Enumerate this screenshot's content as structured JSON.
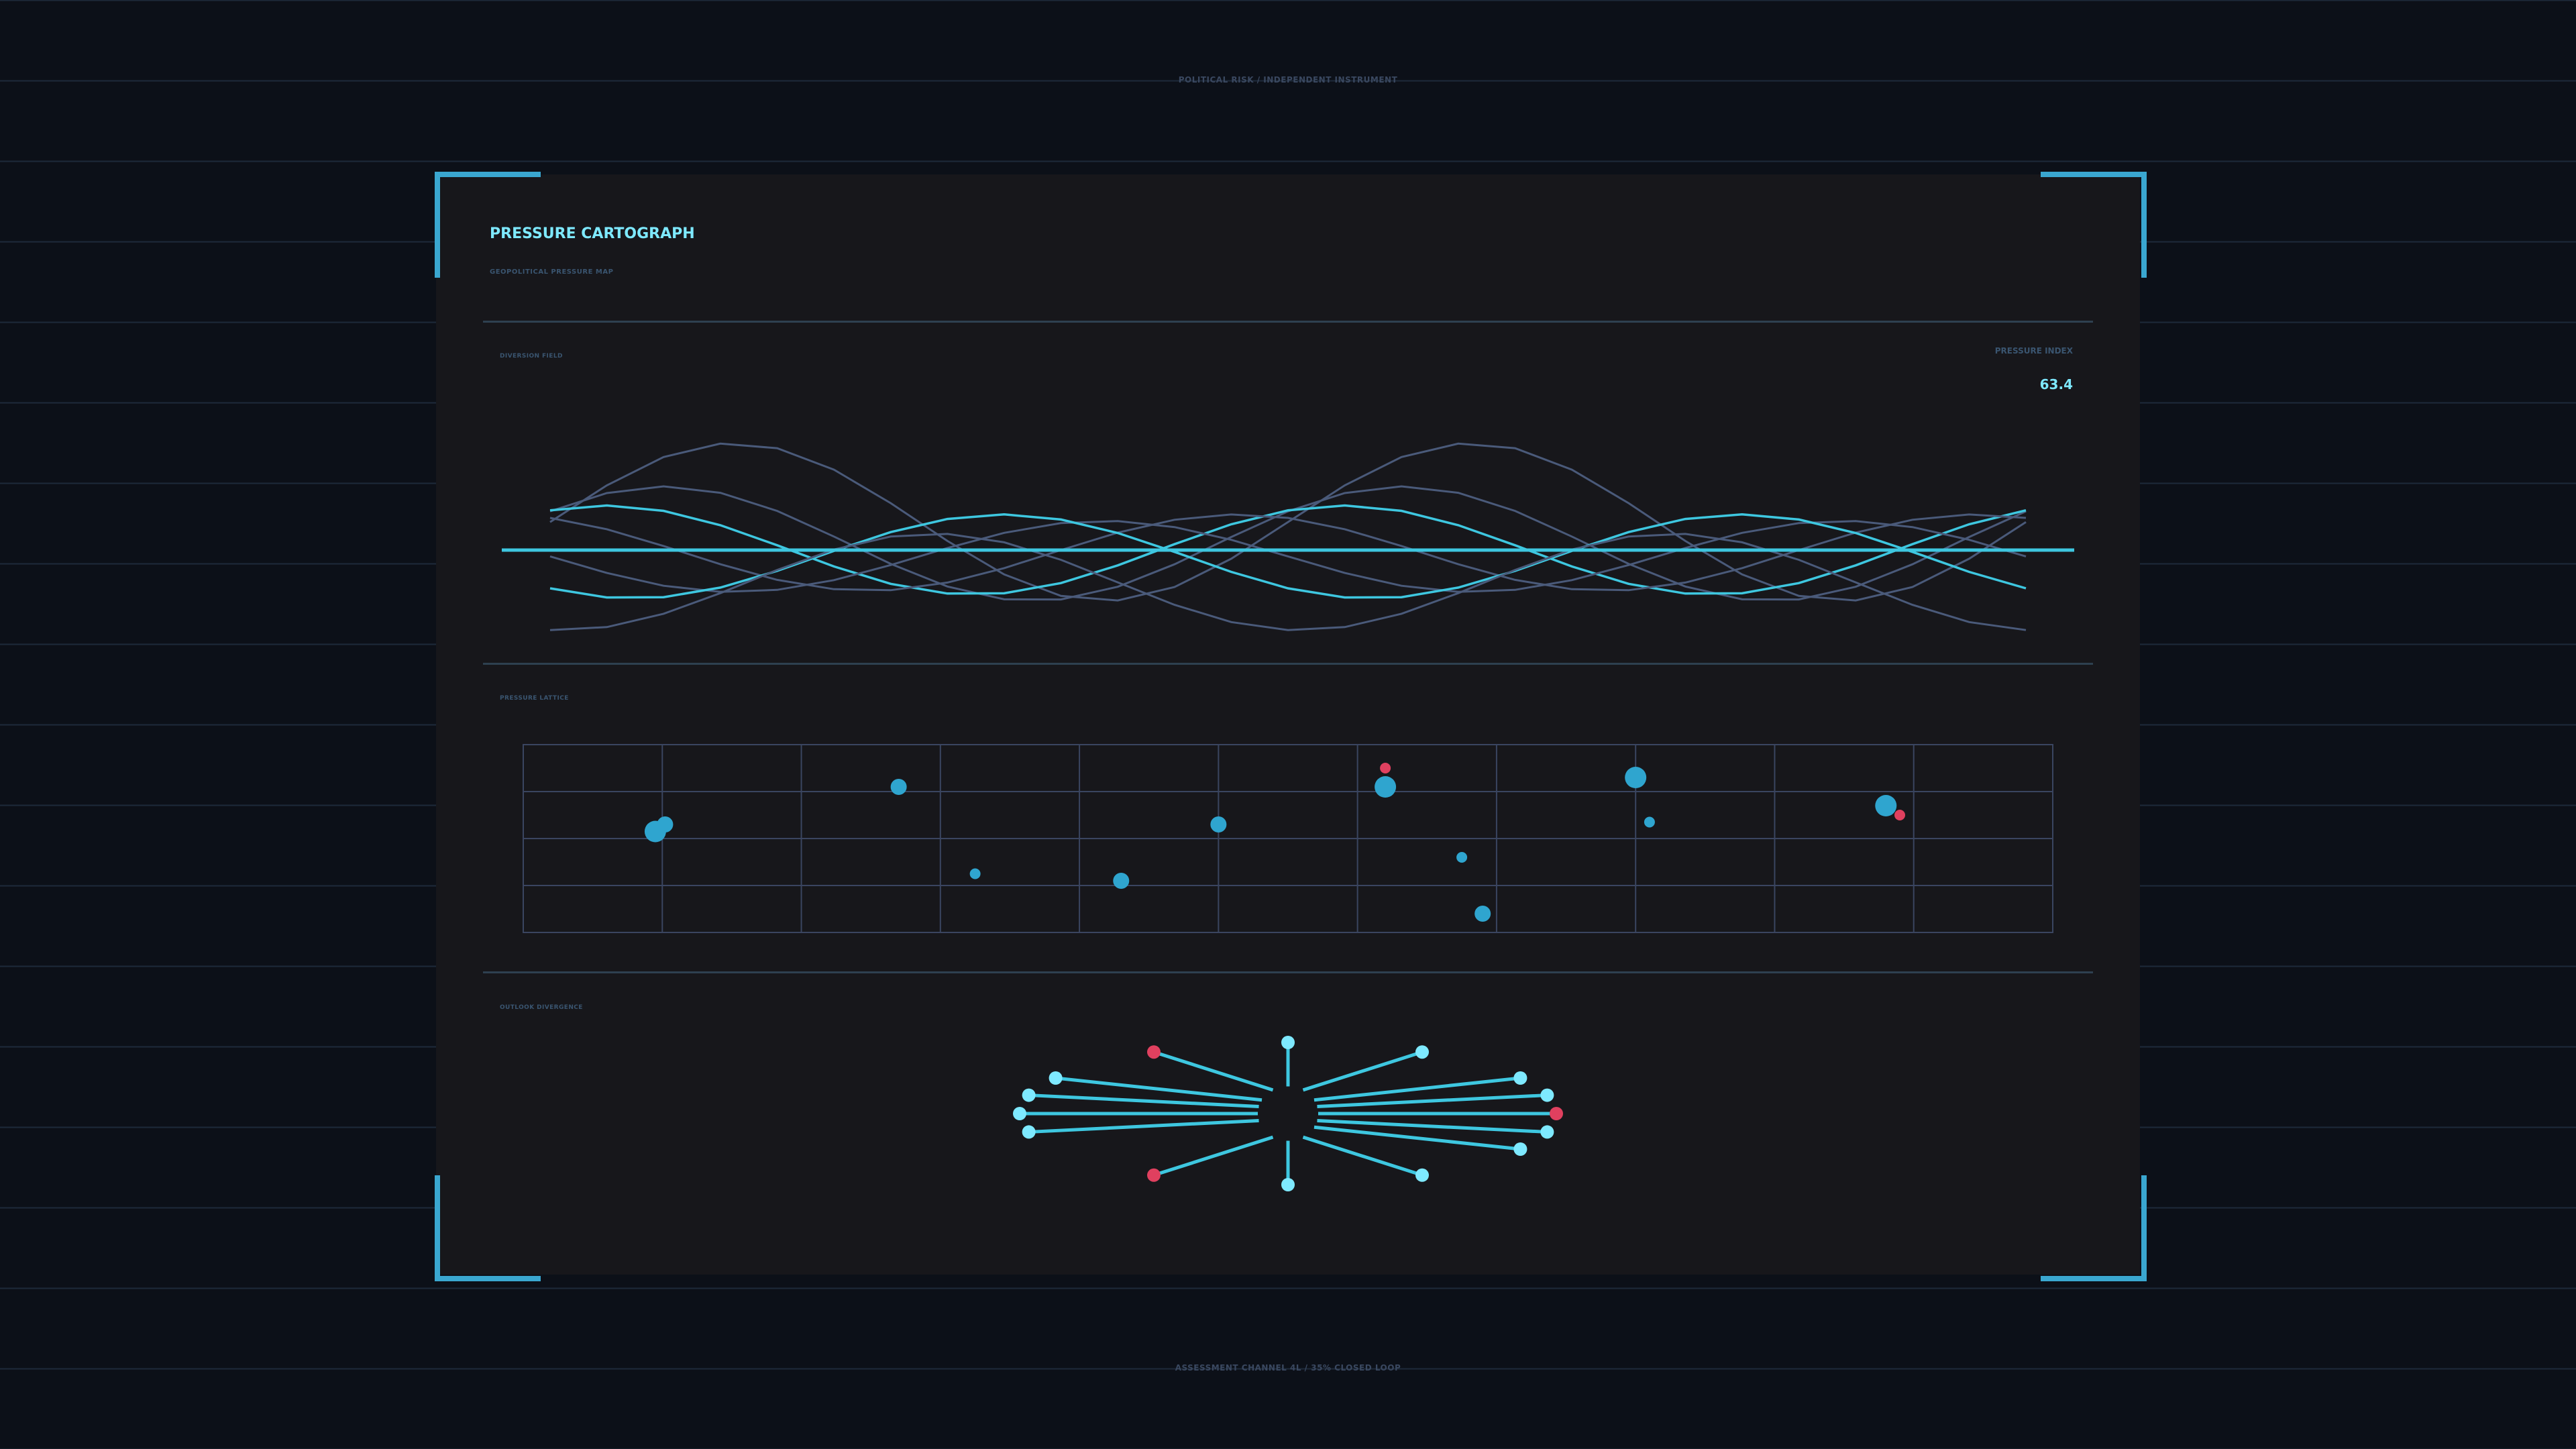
{
  "header": {
    "top_caption": "POLITICAL RISK / INDEPENDENT INSTRUMENT",
    "bottom_caption": "ASSESSMENT CHANNEL 4L  /  35% CLOSED LOOP"
  },
  "panel": {
    "title": "PRESSURE CARTOGRAPH",
    "subtitle": "GEOPOLITICAL PRESSURE MAP"
  },
  "sections": {
    "wave": {
      "label": "DIVERSION FIELD",
      "index_label": "PRESSURE INDEX",
      "index_value": "63.4"
    },
    "lattice": {
      "label": "PRESSURE LATTICE"
    },
    "burst": {
      "label": "OUTLOOK DIVERGENCE"
    }
  },
  "colors": {
    "background": "#0c1018",
    "panel": "#17171b",
    "accent_cyan": "#3ec7e0",
    "accent_bright": "#7ee9ff",
    "accent_blue": "#2fa5cf",
    "alert_red": "#e0405f",
    "muted_line": "#4a5a7a"
  },
  "chart_data": [
    {
      "type": "line",
      "xlim": [
        0,
        1
      ],
      "ylim": [
        -1,
        1
      ],
      "series": [
        {
          "style": "muted",
          "amp": 0.62,
          "phase": 0.0,
          "offset": 0.22
        },
        {
          "style": "muted",
          "amp": 0.45,
          "phase": 0.6,
          "offset": 0.05
        },
        {
          "style": "bright",
          "amp": 0.35,
          "phase": 1.1,
          "offset": 0.0
        },
        {
          "style": "muted",
          "amp": 0.3,
          "phase": 2.0,
          "offset": -0.02
        },
        {
          "style": "muted",
          "amp": 0.28,
          "phase": 3.14,
          "offset": -0.05
        },
        {
          "style": "bright",
          "amp": 0.33,
          "phase": 4.0,
          "offset": -0.05
        },
        {
          "style": "muted",
          "amp": 0.38,
          "phase": 4.6,
          "offset": -0.25
        }
      ],
      "baseline": 0
    },
    {
      "type": "scatter",
      "xlim": [
        0,
        11
      ],
      "ylim": [
        0,
        4
      ],
      "points": [
        {
          "x": 0.95,
          "y": 2.15,
          "size": 3,
          "color": "blue"
        },
        {
          "x": 1.02,
          "y": 2.3,
          "size": 2,
          "color": "blue"
        },
        {
          "x": 2.7,
          "y": 3.1,
          "size": 2,
          "color": "blue"
        },
        {
          "x": 3.25,
          "y": 1.25,
          "size": 1,
          "color": "blue"
        },
        {
          "x": 4.3,
          "y": 1.1,
          "size": 2,
          "color": "blue"
        },
        {
          "x": 5.0,
          "y": 2.3,
          "size": 2,
          "color": "blue"
        },
        {
          "x": 6.2,
          "y": 3.5,
          "size": 1,
          "color": "red"
        },
        {
          "x": 6.2,
          "y": 3.1,
          "size": 3,
          "color": "blue"
        },
        {
          "x": 6.75,
          "y": 1.6,
          "size": 1,
          "color": "blue"
        },
        {
          "x": 6.9,
          "y": 0.4,
          "size": 2,
          "color": "blue"
        },
        {
          "x": 8.0,
          "y": 3.3,
          "size": 3,
          "color": "blue"
        },
        {
          "x": 8.1,
          "y": 2.35,
          "size": 1,
          "color": "blue"
        },
        {
          "x": 9.8,
          "y": 2.7,
          "size": 3,
          "color": "blue"
        },
        {
          "x": 9.9,
          "y": 2.5,
          "size": 1,
          "color": "red"
        }
      ]
    },
    {
      "type": "radial",
      "spokes": [
        {
          "angle": 0,
          "color": "red"
        },
        {
          "angle": 15,
          "color": "cyan"
        },
        {
          "angle": 30,
          "color": "cyan"
        },
        {
          "angle": 60,
          "color": "cyan"
        },
        {
          "angle": 90,
          "color": "cyan"
        },
        {
          "angle": 120,
          "color": "red"
        },
        {
          "angle": 150,
          "color": "cyan"
        },
        {
          "angle": 165,
          "color": "cyan"
        },
        {
          "angle": 180,
          "color": "cyan"
        },
        {
          "angle": 195,
          "color": "cyan"
        },
        {
          "angle": 240,
          "color": "red"
        },
        {
          "angle": 270,
          "color": "cyan"
        },
        {
          "angle": 300,
          "color": "cyan"
        },
        {
          "angle": 330,
          "color": "cyan"
        },
        {
          "angle": 345,
          "color": "cyan"
        }
      ]
    }
  ]
}
